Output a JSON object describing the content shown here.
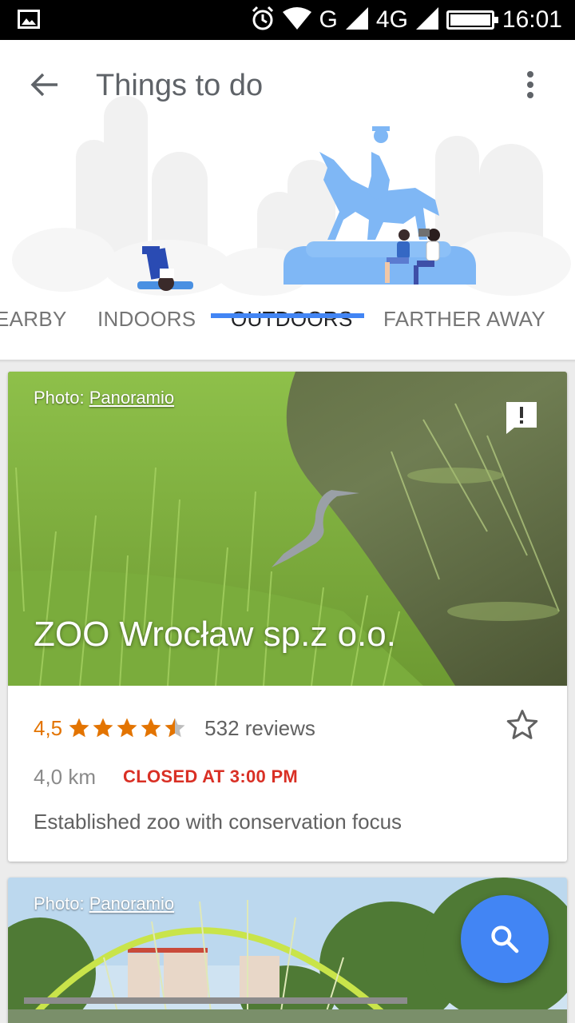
{
  "status_bar": {
    "time": "16:01",
    "network": "G",
    "network2": "4G",
    "icons": [
      "image-icon",
      "alarm-icon",
      "wifi-icon",
      "signal-icon",
      "battery-icon"
    ]
  },
  "header": {
    "title": "Things to do",
    "back_icon": "arrow-back-icon",
    "more_icon": "more-vert-icon"
  },
  "tabs": [
    {
      "label": "EARBY",
      "active": false
    },
    {
      "label": "INDOORS",
      "active": false
    },
    {
      "label": "OUTDOORS",
      "active": true
    },
    {
      "label": "FARTHER AWAY",
      "active": false
    }
  ],
  "cards": [
    {
      "photo_credit_prefix": "Photo: ",
      "photo_credit_link": "Panoramio",
      "name": "ZOO Wrocław sp.z o.o.",
      "rating": "4,5",
      "rating_value": 4.5,
      "reviews": "532 reviews",
      "distance": "4,0 km",
      "status": "CLOSED AT 3:00 PM",
      "description": "Established zoo with conservation focus"
    },
    {
      "photo_credit_prefix": "Photo: ",
      "photo_credit_link": "Panoramio"
    }
  ],
  "fab": {
    "icon": "search-icon"
  },
  "colors": {
    "accent": "#4285f4",
    "rating": "#e37400",
    "closed": "#d93025",
    "illustration": "#7fb7f5"
  }
}
